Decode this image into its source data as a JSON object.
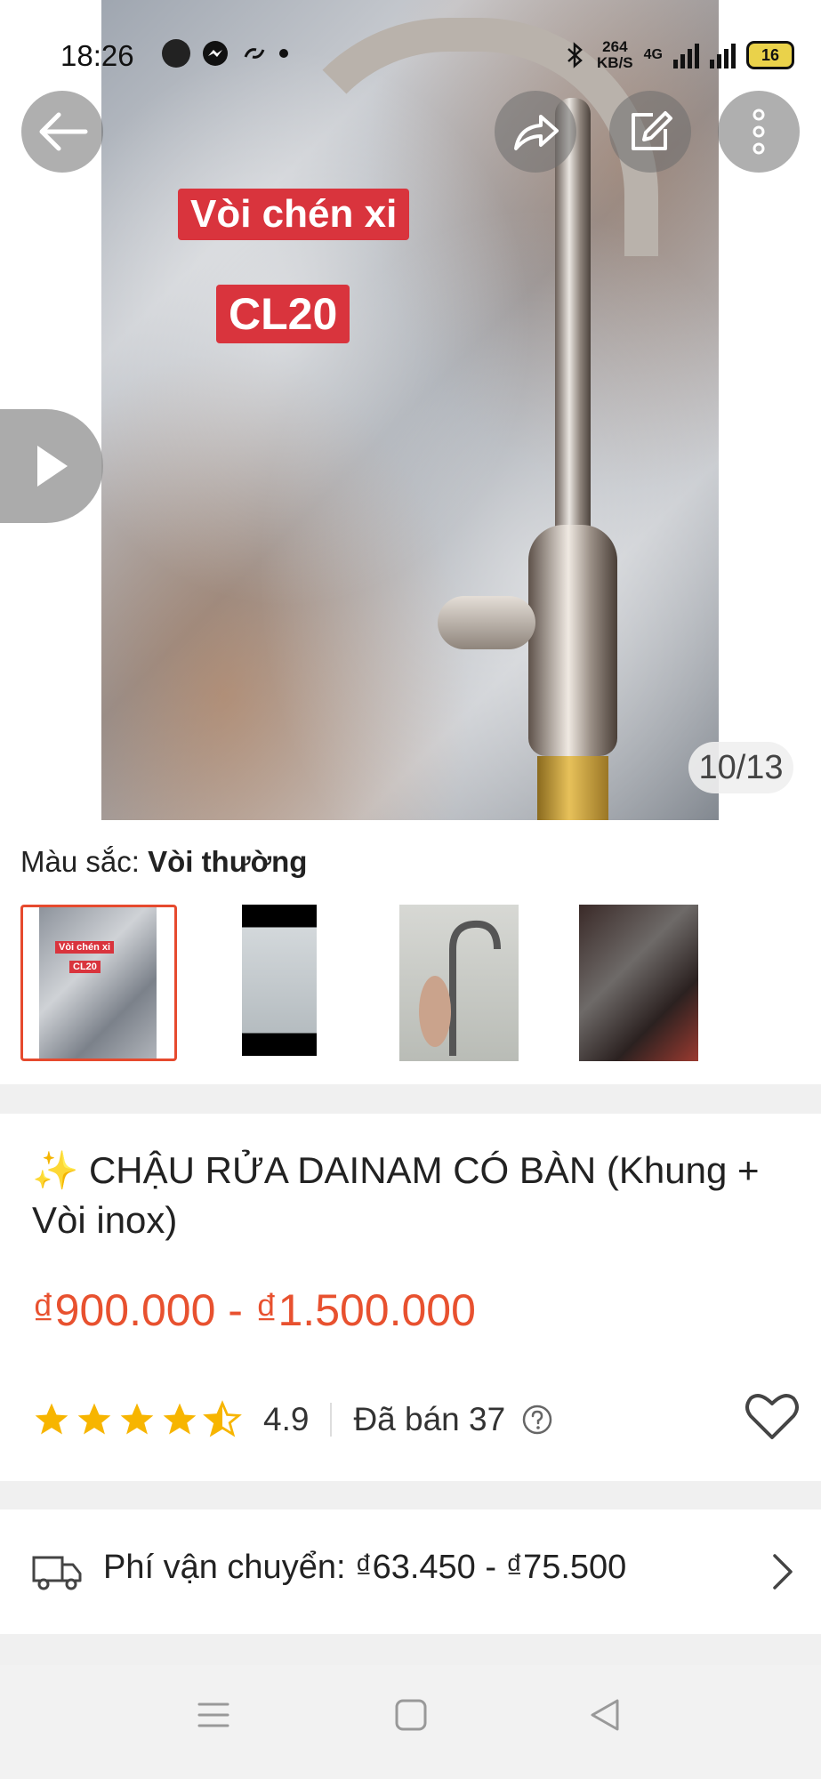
{
  "status_bar": {
    "time": "18:26",
    "net_speed_value": "264",
    "net_speed_unit": "KB/S",
    "network_badge": "4G",
    "battery": "16"
  },
  "gallery": {
    "overlay_text_1": "Vòi chén xi",
    "overlay_text_2": "CL20",
    "counter": "10/13"
  },
  "variant": {
    "label": "Màu sắc: ",
    "value": "Vòi thường",
    "thumb_label_1": "Vòi chén xi",
    "thumb_label_2": "CL20"
  },
  "product": {
    "title": "✨ CHẬU RỬA DAINAM CÓ BÀN (Khung + Vòi inox)",
    "price": "₫900.000 - ₫1.500.000",
    "rating": "4.9",
    "rating_stars": 4.5,
    "sold": "Đã bán 37"
  },
  "shipping": {
    "text": "Phí vận chuyển: ₫63.450 - ₫75.500"
  },
  "colors": {
    "accent": "#e8512f",
    "star": "#f7b500",
    "label_red": "#d9343d"
  }
}
